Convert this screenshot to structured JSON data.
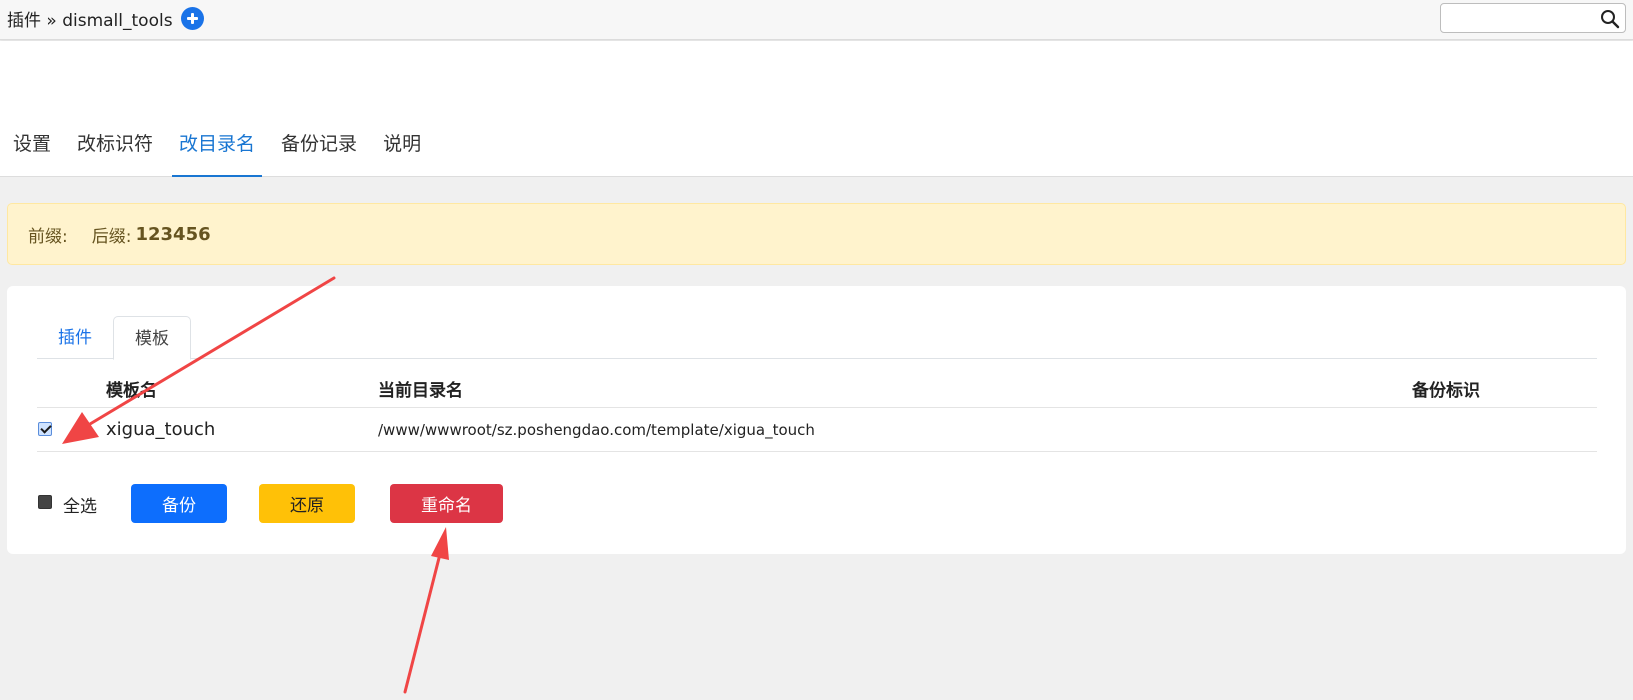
{
  "topbar": {
    "breadcrumb": "插件 » dismall_tools",
    "add_icon": "plus-circle-icon",
    "search": {
      "value": "",
      "placeholder": "",
      "icon": "search-icon"
    }
  },
  "main_tabs": [
    {
      "label": "设置",
      "active": false
    },
    {
      "label": "改标识符",
      "active": false
    },
    {
      "label": "改目录名",
      "active": true
    },
    {
      "label": "备份记录",
      "active": false
    },
    {
      "label": "说明",
      "active": false
    }
  ],
  "notice": {
    "prefix_label": "前缀:",
    "suffix_label": "后缀:",
    "suffix_value": "123456"
  },
  "sub_tabs": [
    {
      "label": "插件",
      "active": false
    },
    {
      "label": "模板",
      "active": true
    }
  ],
  "table": {
    "headers": [
      "模板名",
      "当前目录名",
      "备份标识"
    ],
    "rows": [
      {
        "checked": true,
        "name": "xigua_touch",
        "dir": "/www/wwwroot/sz.poshengdao.com/template/xigua_touch",
        "backup": ""
      }
    ]
  },
  "actions": {
    "select_all_label": "全选",
    "select_all_checked": false,
    "backup_label": "备份",
    "restore_label": "还原",
    "rename_label": "重命名"
  },
  "colors": {
    "accent": "#1976d2",
    "backup_button": "#0d6efd",
    "restore_button": "#ffc107",
    "rename_button": "#dc3545",
    "notice_bg": "#fff3cd",
    "annotation_arrow": "#f04545"
  }
}
